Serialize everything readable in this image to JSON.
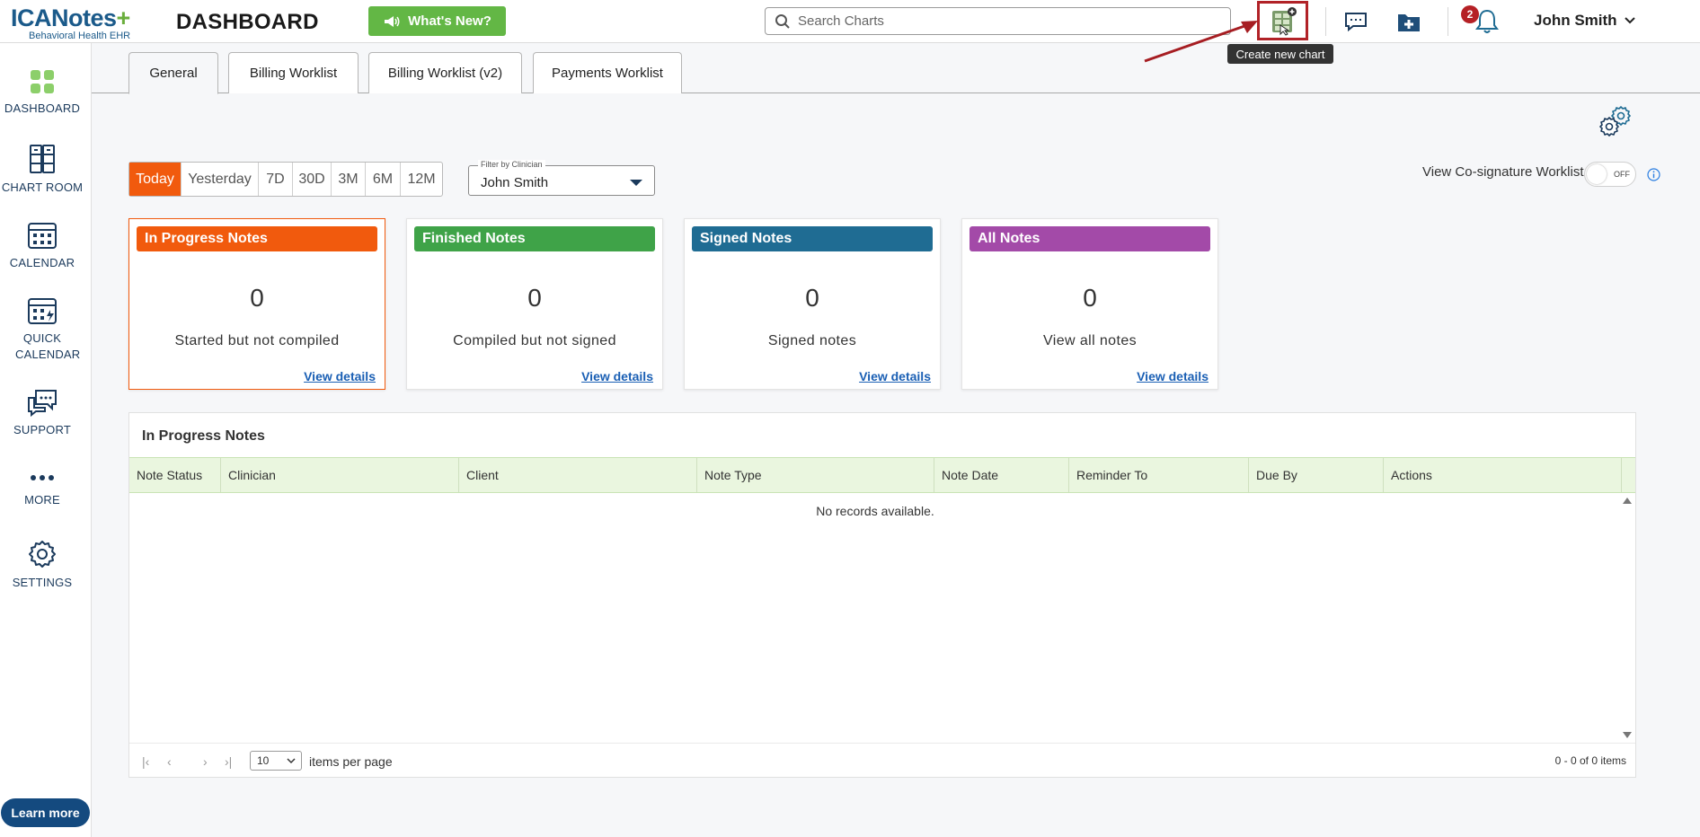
{
  "logo": {
    "name": "ICANotes",
    "subtitle": "Behavioral Health EHR"
  },
  "header": {
    "page_title": "DASHBOARD",
    "whats_new_label": "What's New?",
    "search_placeholder": "Search Charts",
    "notification_count": "2",
    "user_name": "John Smith",
    "tooltip": "Create new chart"
  },
  "sidebar": {
    "items": [
      {
        "label": "DASHBOARD",
        "icon": "dashboard-icon"
      },
      {
        "label": "CHART ROOM",
        "icon": "chart-room-icon"
      },
      {
        "label": "CALENDAR",
        "icon": "calendar-icon"
      },
      {
        "label": "QUICK CALENDAR",
        "icon": "quick-calendar-icon"
      },
      {
        "label": "SUPPORT",
        "icon": "support-icon"
      },
      {
        "label": "MORE",
        "icon": "more-icon"
      },
      {
        "label": "SETTINGS",
        "icon": "settings-icon"
      }
    ],
    "learn_more": "Learn more"
  },
  "tabs": [
    {
      "label": "General",
      "active": true
    },
    {
      "label": "Billing Worklist",
      "active": false
    },
    {
      "label": "Billing Worklist (v2)",
      "active": false
    },
    {
      "label": "Payments Worklist",
      "active": false
    }
  ],
  "date_range": {
    "options": [
      "Today",
      "Yesterday",
      "7D",
      "30D",
      "3M",
      "6M",
      "12M"
    ],
    "selected": "Today"
  },
  "clinician_filter": {
    "label": "Filter by Clinician",
    "value": "John Smith"
  },
  "cosignature": {
    "label": "View Co-signature Worklist",
    "toggle_state": "OFF"
  },
  "cards": [
    {
      "title": "In Progress Notes",
      "count": "0",
      "description": "Started but not compiled",
      "link": "View details",
      "color": "#f15a0d"
    },
    {
      "title": "Finished Notes",
      "count": "0",
      "description": "Compiled but not signed",
      "link": "View details",
      "color": "#3fa348"
    },
    {
      "title": "Signed Notes",
      "count": "0",
      "description": "Signed notes",
      "link": "View details",
      "color": "#1f6c93"
    },
    {
      "title": "All Notes",
      "count": "0",
      "description": "View all notes",
      "link": "View details",
      "color": "#a34aa8"
    }
  ],
  "grid": {
    "title": "In Progress Notes",
    "columns": [
      "Note Status",
      "Clinician",
      "Client",
      "Note Type",
      "Note Date",
      "Reminder To",
      "Due By",
      "Actions"
    ],
    "empty_message": "No records available.",
    "page_size": "10",
    "items_per_page_label": "items per page",
    "info": "0 - 0 of 0 items"
  }
}
